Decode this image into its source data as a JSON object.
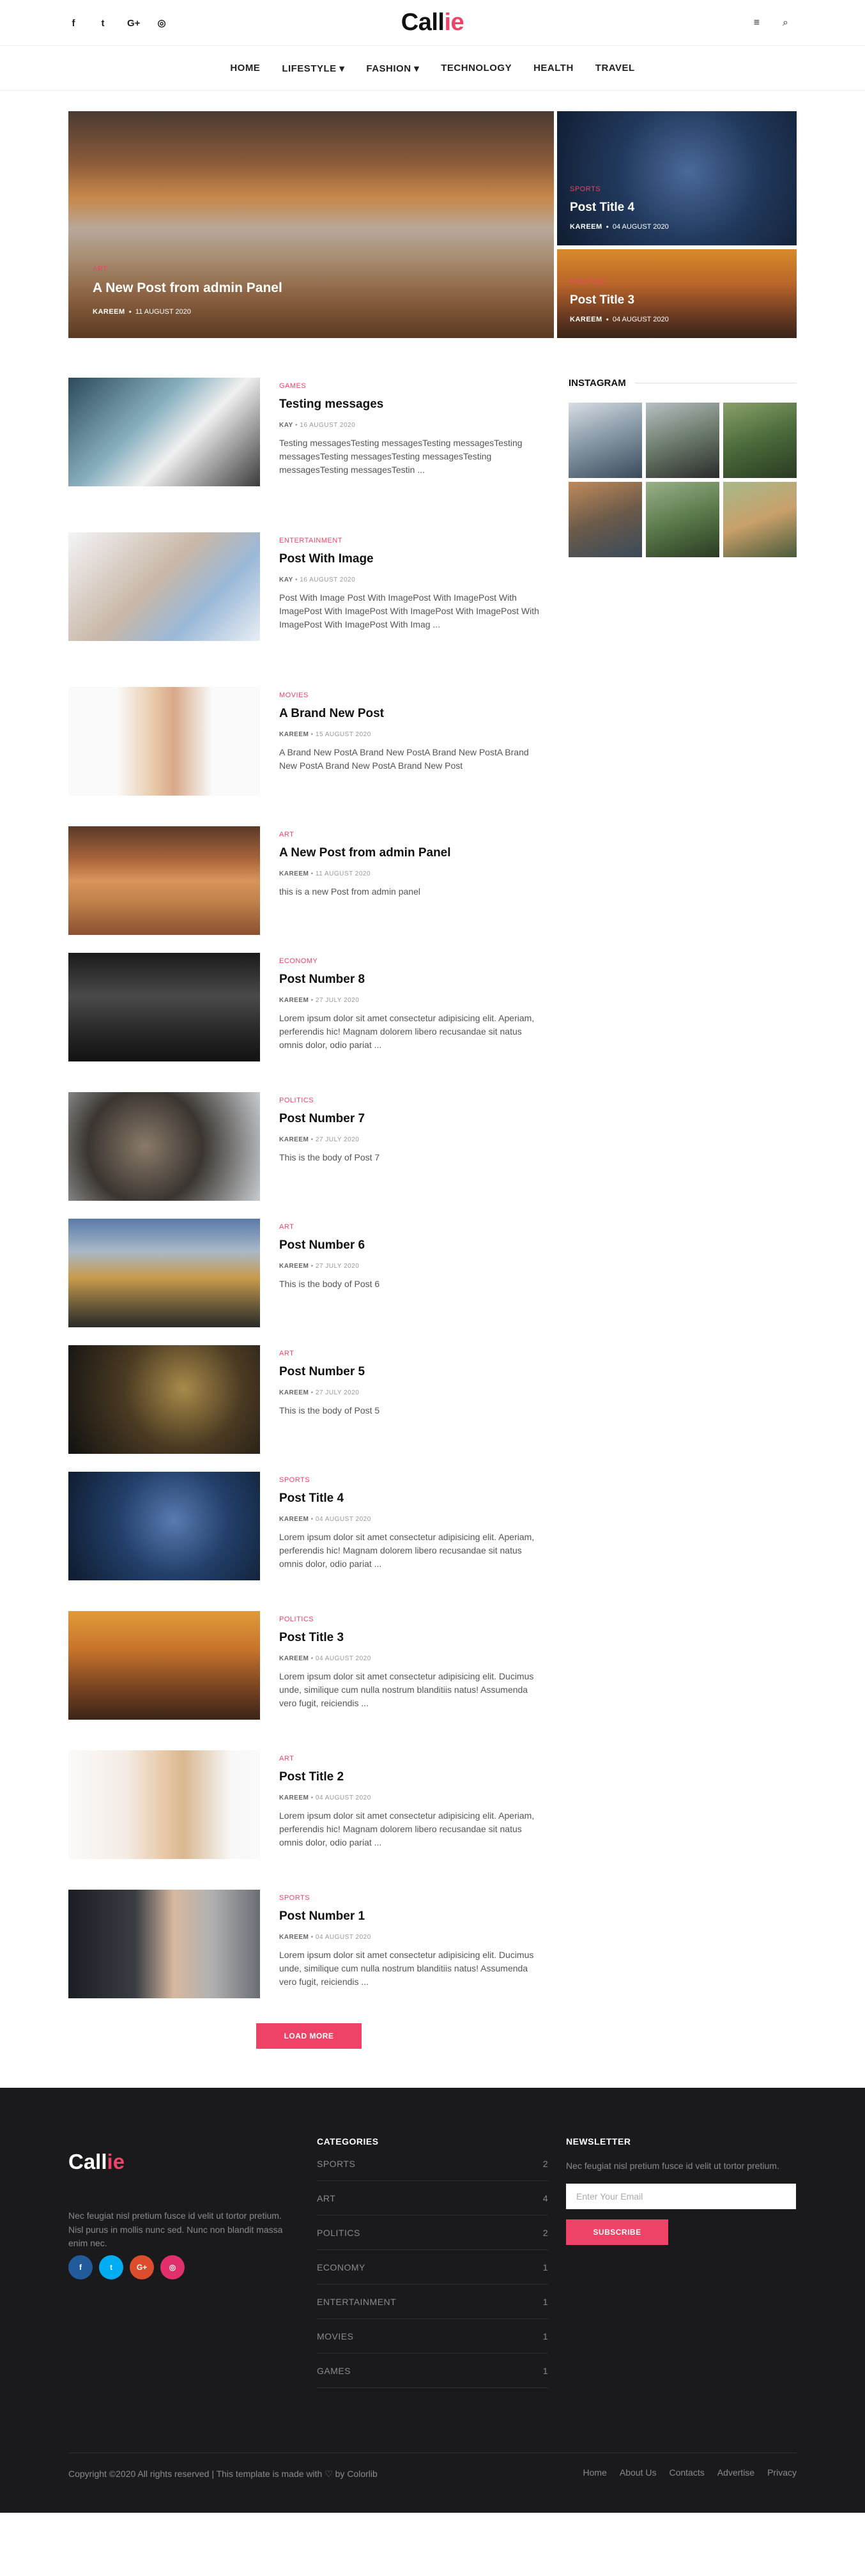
{
  "header": {
    "social_icons": [
      "facebook-icon",
      "twitter-icon",
      "google-plus-icon",
      "instagram-icon"
    ],
    "social_glyphs": [
      "f",
      "t",
      "G+",
      "◎"
    ],
    "logo_main": "Call",
    "logo_accent": "ie",
    "menu_icon": "≡",
    "search_icon": "⌕"
  },
  "nav": {
    "items": [
      "HOME",
      "LIFESTYLE ▾",
      "FASHION ▾",
      "TECHNOLOGY",
      "HEALTH",
      "TRAVEL"
    ]
  },
  "hero": {
    "main": {
      "category": "ART",
      "title": "A New Post from admin Panel",
      "author": "KAREEM",
      "date": "11 AUGUST 2020"
    },
    "side1": {
      "category": "SPORTS",
      "title": "Post Title 4",
      "author": "KAREEM",
      "date": "04 AUGUST 2020"
    },
    "side2": {
      "category": "POLITICS",
      "title": "Post Title 3",
      "author": "KAREEM",
      "date": "04 AUGUST 2020"
    }
  },
  "posts": [
    {
      "category": "GAMES",
      "title": "Testing messages",
      "author": "KAY",
      "date": "16 AUGUST 2020",
      "excerpt": "Testing messagesTesting messagesTesting messagesTesting messagesTesting messagesTesting messagesTesting messagesTesting messagesTestin ..."
    },
    {
      "category": "ENTERTAINMENT",
      "title": "Post With Image",
      "author": "KAY",
      "date": "16 AUGUST 2020",
      "excerpt": "Post With Image Post With ImagePost With ImagePost With ImagePost With ImagePost With ImagePost With ImagePost With ImagePost With ImagePost With Imag ..."
    },
    {
      "category": "MOVIES",
      "title": "A Brand New Post",
      "author": "KAREEM",
      "date": "15 AUGUST 2020",
      "excerpt": "A Brand New PostA Brand New PostA Brand New PostA Brand New PostA Brand New PostA Brand New Post"
    },
    {
      "category": "ART",
      "title": "A New Post from admin Panel",
      "author": "KAREEM",
      "date": "11 AUGUST 2020",
      "excerpt": "this is a new Post from admin panel"
    },
    {
      "category": "ECONOMY",
      "title": "Post Number 8",
      "author": "KAREEM",
      "date": "27 JULY 2020",
      "excerpt": "Lorem ipsum dolor sit amet consectetur adipisicing elit. Aperiam, perferendis hic! Magnam dolorem libero recusandae sit natus omnis dolor, odio pariat ..."
    },
    {
      "category": "POLITICS",
      "title": "Post Number 7",
      "author": "KAREEM",
      "date": "27 JULY 2020",
      "excerpt": "This is the body of Post 7"
    },
    {
      "category": "ART",
      "title": "Post Number 6",
      "author": "KAREEM",
      "date": "27 JULY 2020",
      "excerpt": "This is the body of Post 6"
    },
    {
      "category": "ART",
      "title": "Post Number 5",
      "author": "KAREEM",
      "date": "27 JULY 2020",
      "excerpt": "This is the body of Post 5"
    },
    {
      "category": "SPORTS",
      "title": "Post Title 4",
      "author": "KAREEM",
      "date": "04 AUGUST 2020",
      "excerpt": "Lorem ipsum dolor sit amet consectetur adipisicing elit. Aperiam, perferendis hic! Magnam dolorem libero recusandae sit natus omnis dolor, odio pariat ..."
    },
    {
      "category": "POLITICS",
      "title": "Post Title 3",
      "author": "KAREEM",
      "date": "04 AUGUST 2020",
      "excerpt": "Lorem ipsum dolor sit amet consectetur adipisicing elit. Ducimus unde, similique cum nulla nostrum blanditiis natus! Assumenda vero fugit, reiciendis ..."
    },
    {
      "category": "ART",
      "title": "Post Title 2",
      "author": "KAREEM",
      "date": "04 AUGUST 2020",
      "excerpt": "Lorem ipsum dolor sit amet consectetur adipisicing elit. Aperiam, perferendis hic! Magnam dolorem libero recusandae sit natus omnis dolor, odio pariat ..."
    },
    {
      "category": "SPORTS",
      "title": "Post Number 1",
      "author": "KAREEM",
      "date": "04 AUGUST 2020",
      "excerpt": "Lorem ipsum dolor sit amet consectetur adipisicing elit. Ducimus unde, similique cum nulla nostrum blanditiis natus! Assumenda vero fugit, reiciendis ..."
    }
  ],
  "load_more": "LOAD MORE",
  "sidebar": {
    "instagram_title": "INSTAGRAM",
    "photo_count": 6
  },
  "footer": {
    "logo_main": "Call",
    "logo_accent": "ie",
    "description": "Nec feugiat nisl pretium fusce id velit ut tortor pretium. Nisl purus in mollis nunc sed. Nunc non blandit massa enim nec.",
    "social_glyphs": [
      "f",
      "t",
      "G+",
      "◎"
    ],
    "social_colors": [
      "#225b99",
      "#00adf2",
      "#dc4d2d",
      "#e1306c"
    ],
    "categories_title": "CATEGORIES",
    "categories": [
      {
        "name": "SPORTS",
        "count": "2"
      },
      {
        "name": "ART",
        "count": "4"
      },
      {
        "name": "POLITICS",
        "count": "2"
      },
      {
        "name": "ECONOMY",
        "count": "1"
      },
      {
        "name": "ENTERTAINMENT",
        "count": "1"
      },
      {
        "name": "MOVIES",
        "count": "1"
      },
      {
        "name": "GAMES",
        "count": "1"
      }
    ],
    "newsletter_title": "NEWSLETTER",
    "newsletter_desc": "Nec feugiat nisl pretium fusce id velit ut tortor pretium.",
    "newsletter_placeholder": "Enter Your Email",
    "subscribe": "SUBSCRIBE",
    "copyright": "Copyright ©2020 All rights reserved | This template is made with ♡ by Colorlib",
    "links": [
      "Home",
      "About Us",
      "Contacts",
      "Advertise",
      "Privacy"
    ]
  },
  "colors": {
    "accent": "#ee4266",
    "footer_bg": "#1a1a1d"
  }
}
